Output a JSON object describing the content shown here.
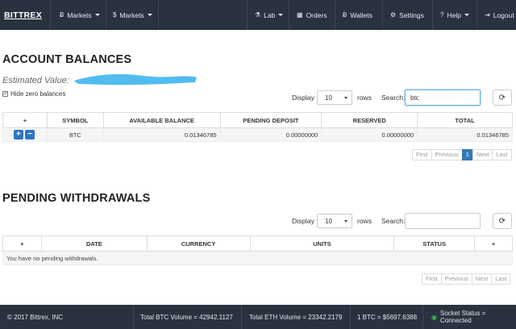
{
  "nav": {
    "brand": "BITTREX",
    "markets_btc": "Markets",
    "markets_usd": "Markets",
    "lab": "Lab",
    "orders": "Orders",
    "wallets": "Wallets",
    "settings": "Settings",
    "help": "Help",
    "logout": "Logout",
    "icons": {
      "btc": "Ƀ",
      "usd": "$",
      "lab": "⚗",
      "orders": "▦",
      "wallets": "Ƀ",
      "settings": "⚙",
      "help": "?",
      "logout": "⇥"
    }
  },
  "balances": {
    "title": "ACCOUNT BALANCES",
    "estimated_label": "Estimated Value:",
    "hide_zero": "Hide zero balances",
    "display_label": "Display",
    "rows_value": "10",
    "rows_label": "rows",
    "search_label": "Search:",
    "search_value": "btc",
    "columns": [
      "+",
      "SYMBOL",
      "AVAILABLE BALANCE",
      "PENDING DEPOSIT",
      "RESERVED",
      "TOTAL"
    ],
    "rows": [
      {
        "symbol": "BTC",
        "available": "0.01346785",
        "pending": "0.00000000",
        "reserved": "0.00000000",
        "total": "0.01346785"
      }
    ],
    "pager": {
      "first": "First",
      "previous": "Previous",
      "page": "1",
      "next": "Next",
      "last": "Last"
    }
  },
  "withdrawals": {
    "title": "PENDING WITHDRAWALS",
    "display_label": "Display",
    "rows_value": "10",
    "rows_label": "rows",
    "search_label": "Search:",
    "search_value": "",
    "columns": [
      "+",
      "DATE",
      "CURRENCY",
      "UNITS",
      "STATUS",
      "+"
    ],
    "empty_text": "You have no pending withdrawals.",
    "pager": {
      "first": "First",
      "previous": "Previous",
      "next": "Next",
      "last": "Last"
    }
  },
  "footer": {
    "copyright": "© 2017 Bittrex, INC",
    "btc_volume": "Total BTC Volume = 42942.1127",
    "eth_volume": "Total ETH Volume = 23342.2179",
    "btc_price": "1 BTC = $5697.6388",
    "socket_status": "Socket Status = Connected"
  },
  "colors": {
    "navbar": "#2a3240",
    "accent": "#337ab7",
    "connected": "#39c04d"
  }
}
